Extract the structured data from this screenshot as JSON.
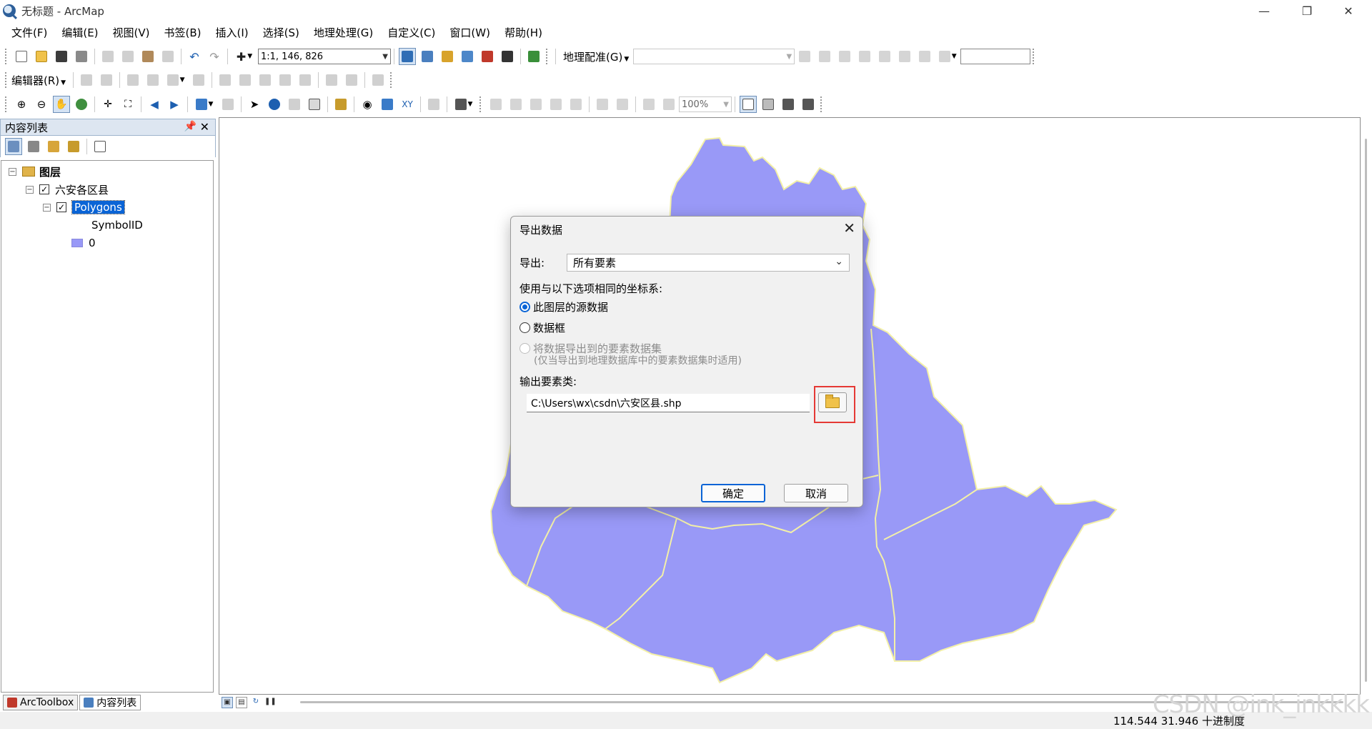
{
  "window": {
    "title": "无标题 - ArcMap",
    "controls": [
      "minimize-icon",
      "restore-icon",
      "close-icon"
    ]
  },
  "menubar": {
    "items": [
      "文件(F)",
      "编辑(E)",
      "视图(V)",
      "书签(B)",
      "插入(I)",
      "选择(S)",
      "地理处理(G)",
      "自定义(C)",
      "窗口(W)",
      "帮助(H)"
    ]
  },
  "toolbar1": {
    "scale_value": "1:1, 146, 826",
    "georef_label": "地理配准(G)",
    "georef_layer_value": "",
    "georef_text_value": ""
  },
  "toolbar2": {
    "editor_label": "编辑器(R)"
  },
  "toolbar3": {
    "zoom_value": "100%"
  },
  "toc": {
    "title": "内容列表",
    "root_label": "图层",
    "layer_group": "六安各区县",
    "layer_name": "Polygons",
    "field_name": "SymbolID",
    "symbol_value": "0",
    "symbol_color": "#9999f7"
  },
  "bottom_tabs": {
    "arctoolbox": "ArcToolbox",
    "toc": "内容列表"
  },
  "map": {
    "fill_color": "#9999f7",
    "boundary_color": "#f3f0a8"
  },
  "status": {
    "coords": "114.544  31.946 十进制度",
    "watermark": "CSDN @ink_inkkkk"
  },
  "dialog": {
    "title": "导出数据",
    "export_label": "导出:",
    "export_value": "所有要素",
    "coord_label": "使用与以下选项相同的坐标系:",
    "radio_source": "此图层的源数据",
    "radio_frame": "数据框",
    "radio_dataset": "将数据导出到的要素数据集",
    "radio_dataset_hint": "(仅当导出到地理数据库中的要素数据集时适用)",
    "output_label": "输出要素类:",
    "output_path": "C:\\Users\\wx\\csdn\\六安区县.shp",
    "ok_label": "确定",
    "cancel_label": "取消"
  }
}
